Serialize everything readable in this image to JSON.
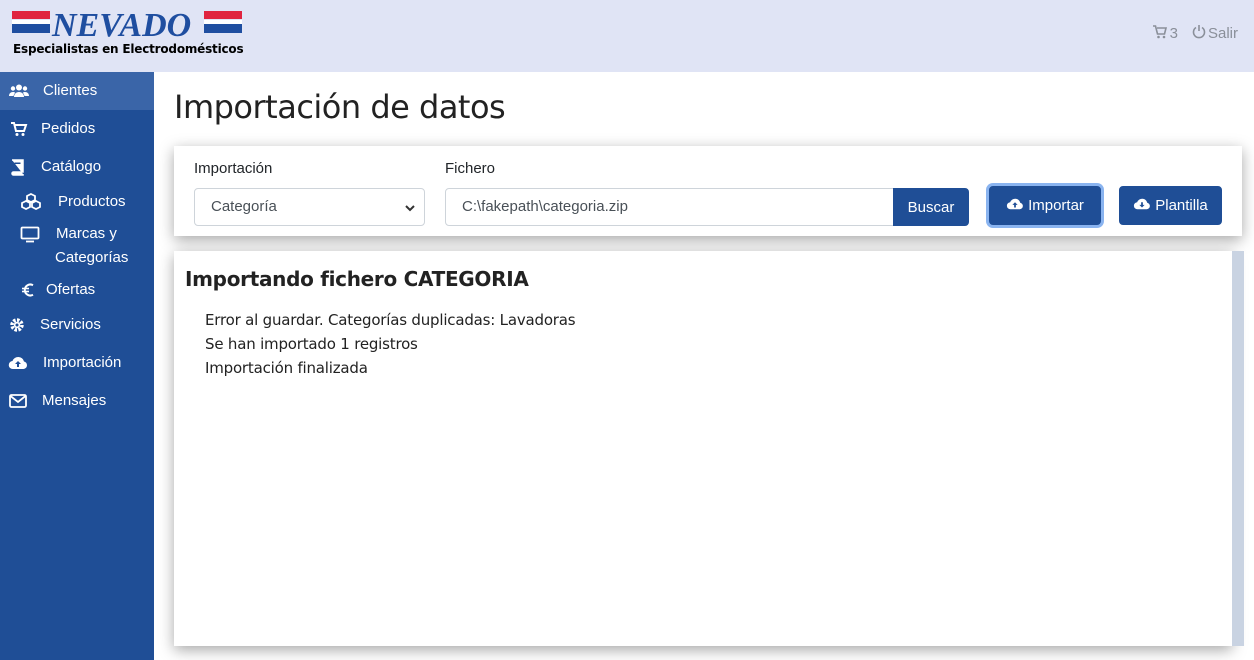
{
  "header": {
    "logo_title": "NEVADO",
    "logo_subtitle": "Especialistas en Electrodomésticos",
    "cart_count": "3",
    "logout_label": "Salir",
    "brand_blue": "#1f4ea0",
    "brand_red": "#e0233f"
  },
  "sidebar": {
    "items": [
      {
        "label": "Clientes",
        "icon": "users-icon"
      },
      {
        "label": "Pedidos",
        "icon": "cart-icon"
      },
      {
        "label": "Catálogo",
        "icon": "book-icon"
      },
      {
        "label": "Productos",
        "icon": "cubes-icon"
      },
      {
        "label": "Marcas y",
        "label2": "Categorías",
        "icon": "monitor-icon"
      },
      {
        "label": "Ofertas",
        "icon": "euro-icon"
      },
      {
        "label": "Servicios",
        "icon": "gear-icon"
      },
      {
        "label": "Importación",
        "icon": "cloud-upload-icon"
      },
      {
        "label": "Mensajes",
        "icon": "envelope-icon"
      }
    ],
    "active": "Clientes"
  },
  "main": {
    "title": "Importación de datos",
    "form": {
      "import_label": "Importación",
      "import_value": "Categoría",
      "file_label": "Fichero",
      "file_value": "C:\\fakepath\\categoria.zip",
      "browse_label": "Buscar",
      "import_button": "Importar",
      "template_button": "Plantilla"
    },
    "log": {
      "title": "Importando fichero CATEGORIA",
      "lines": [
        "Error al guardar. Categorías duplicadas: Lavadoras",
        "Se han importado 1 registros",
        "Importación finalizada"
      ]
    }
  }
}
